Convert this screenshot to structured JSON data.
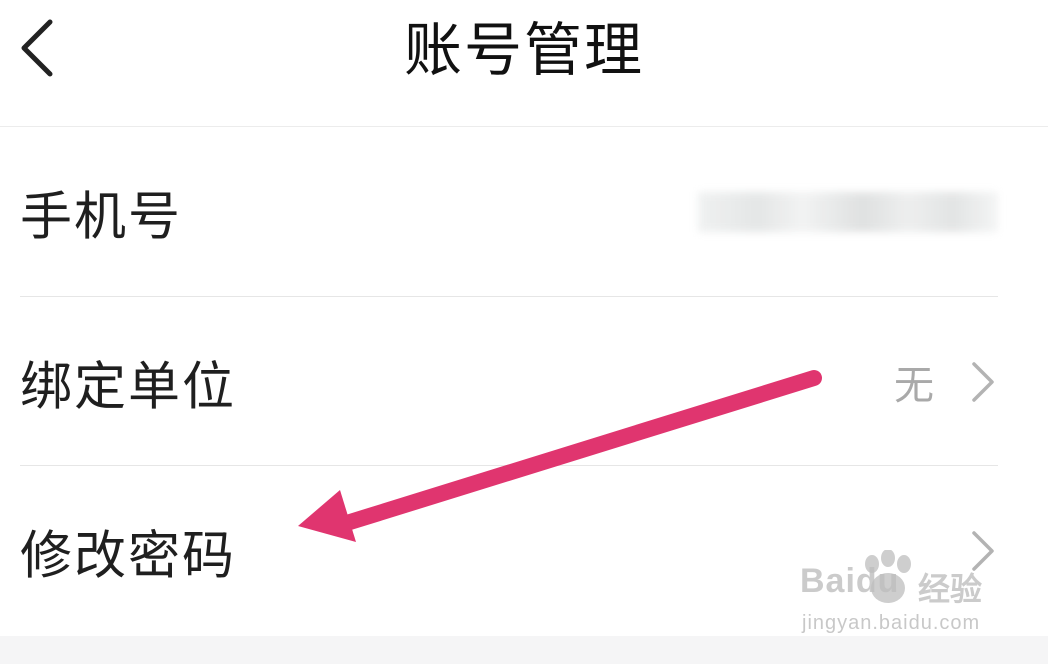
{
  "header": {
    "title": "账号管理",
    "back_icon": "chevron-left-icon"
  },
  "rows": [
    {
      "label": "手机号",
      "value": ""
    },
    {
      "label": "绑定单位",
      "value": "无",
      "icon": "chevron-right-icon"
    },
    {
      "label": "修改密码",
      "icon": "chevron-right-icon"
    }
  ],
  "annotation": {
    "arrow_color": "#e0356f",
    "icon": "arrow-annotation"
  },
  "watermark": {
    "brand": "Baidu",
    "text_cn": "经验",
    "url": "jingyan.baidu.com"
  },
  "colors": {
    "background": "#ffffff",
    "text": "#1f1f1f",
    "secondary_text": "#a9a9a9",
    "divider": "#e6e6e6",
    "arrow": "#e0356f"
  }
}
